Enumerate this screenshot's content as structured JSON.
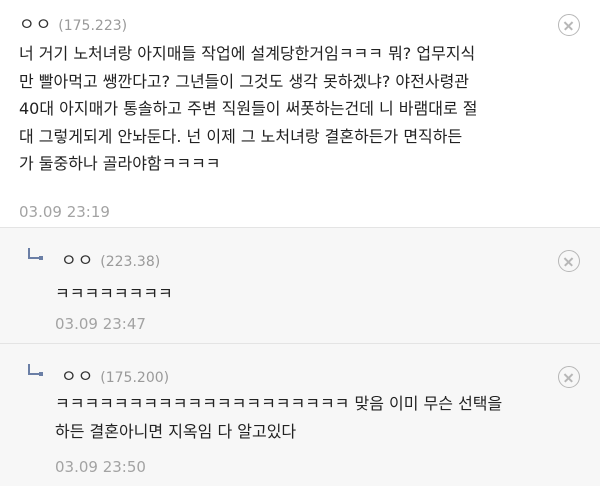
{
  "comments": [
    {
      "nick": "ㅇㅇ",
      "ip": "(175.223)",
      "lines": [
        "너 거기 노처녀랑 아지매들 작업에 설계당한거임ㅋㅋㅋ 뭐? 업무지식",
        "만 빨아먹고 쌩깐다고? 그년들이 그것도 생각 못하겠냐? 야전사령관",
        "40대 아지매가 통솔하고 주변 직원들이 써폿하는건데 니 바램대로 절",
        "대 그렇게되게 안놔둔다. 넌 이제 그 노처녀랑 결혼하든가 면직하든",
        "가 둘중하나 골라야함ㅋㅋㅋㅋ"
      ],
      "time": "03.09 23:19",
      "close_icon": "close-circle-icon"
    },
    {
      "nick": "ㅇㅇ",
      "ip": "(223.38)",
      "lines": [
        "ㅋㅋㅋㅋㅋㅋㅋㅋ"
      ],
      "time": "03.09 23:47",
      "reply_icon": "reply-arrow-icon",
      "close_icon": "close-circle-icon"
    },
    {
      "nick": "ㅇㅇ",
      "ip": "(175.200)",
      "lines": [
        "ㅋㅋㅋㅋㅋㅋㅋㅋㅋㅋㅋㅋㅋㅋㅋㅋㅋㅋㅋㅋ 맞음 이미 무슨 선택을",
        "하든 결혼아니면 지옥임 다 알고있다"
      ],
      "time": "03.09 23:50",
      "reply_icon": "reply-arrow-icon",
      "close_icon": "close-circle-icon"
    }
  ],
  "colors": {
    "reply_bg": "#f7f7f7",
    "reply_arrow": "#6b7fa6",
    "meta_text": "#a3a3a3"
  }
}
